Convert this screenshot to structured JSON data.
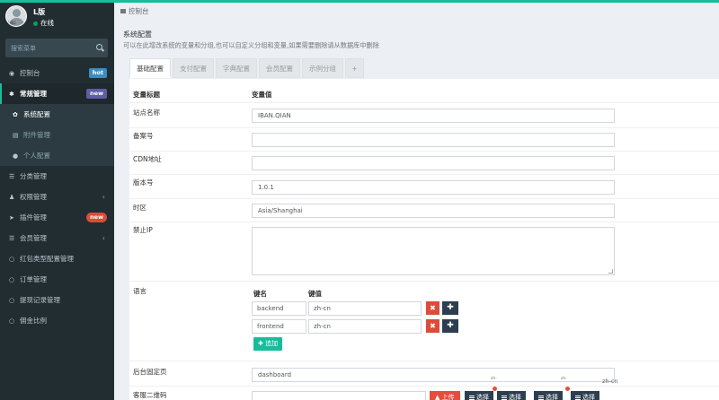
{
  "user": {
    "name": "L版",
    "status": "在线",
    "avatar_tag": "L版1"
  },
  "search": {
    "placeholder": "搜索菜单"
  },
  "menu": {
    "dashboard": {
      "label": "控制台",
      "badge": "hot"
    },
    "general": {
      "label": "常规管理",
      "badge": "new"
    },
    "general_config": {
      "label": "系统配置"
    },
    "attachment": {
      "label": "附件管理"
    },
    "profile": {
      "label": "个人配置"
    },
    "category": {
      "label": "分类管理"
    },
    "auth": {
      "label": "权限管理"
    },
    "addon": {
      "label": "插件管理",
      "badge": "new"
    },
    "member": {
      "label": "会员管理"
    },
    "redpacket": {
      "label": "红包类型配置管理"
    },
    "order": {
      "label": "订单管理"
    },
    "withdraw": {
      "label": "提现记录管理"
    },
    "commission": {
      "label": "佣金比例"
    }
  },
  "breadcrumb": {
    "label": "控制台"
  },
  "panel": {
    "title": "系统配置",
    "description": "可以在此增改系统的变量和分组,也可以自定义分组和变量,如果需要删除请从数据库中删除"
  },
  "tabs": [
    "基础配置",
    "支付配置",
    "字典配置",
    "会员配置",
    "示例分组",
    "+"
  ],
  "table_headers": {
    "name": "变量标题",
    "value": "变量值"
  },
  "fields": {
    "site_name": {
      "label": "站点名称",
      "value": "IBAN.QIAN"
    },
    "beian": {
      "label": "备案号",
      "value": ""
    },
    "cdn": {
      "label": "CDN地址",
      "value": ""
    },
    "version": {
      "label": "版本号",
      "value": "1.0.1"
    },
    "timezone": {
      "label": "时区",
      "value": "Asia/Shanghai"
    },
    "forbidden_ip": {
      "label": "禁止IP",
      "value": ""
    },
    "language": {
      "label": "语言",
      "key_header": "键名",
      "value_header": "键值",
      "rows": [
        {
          "key": "backend",
          "value": "zh-cn"
        },
        {
          "key": "frontend",
          "value": "zh-cn"
        }
      ],
      "add_label": "追加"
    },
    "fixed_page": {
      "label": "后台固定页",
      "value": "dashboard"
    },
    "qrcode": {
      "label": "客服二维码",
      "value": "",
      "upload_label": "上传",
      "choose_label": "选择"
    }
  },
  "bottom_overlay": {
    "thumb_a": "zh-",
    "thumb_b": "zh-",
    "thumb_c": "zh-cn",
    "choose_label": "选择"
  },
  "colors": {
    "sidebar_bg": "#222d32",
    "accent": "#1abc9c",
    "danger": "#dd4b39",
    "dark": "#2c3e50"
  }
}
